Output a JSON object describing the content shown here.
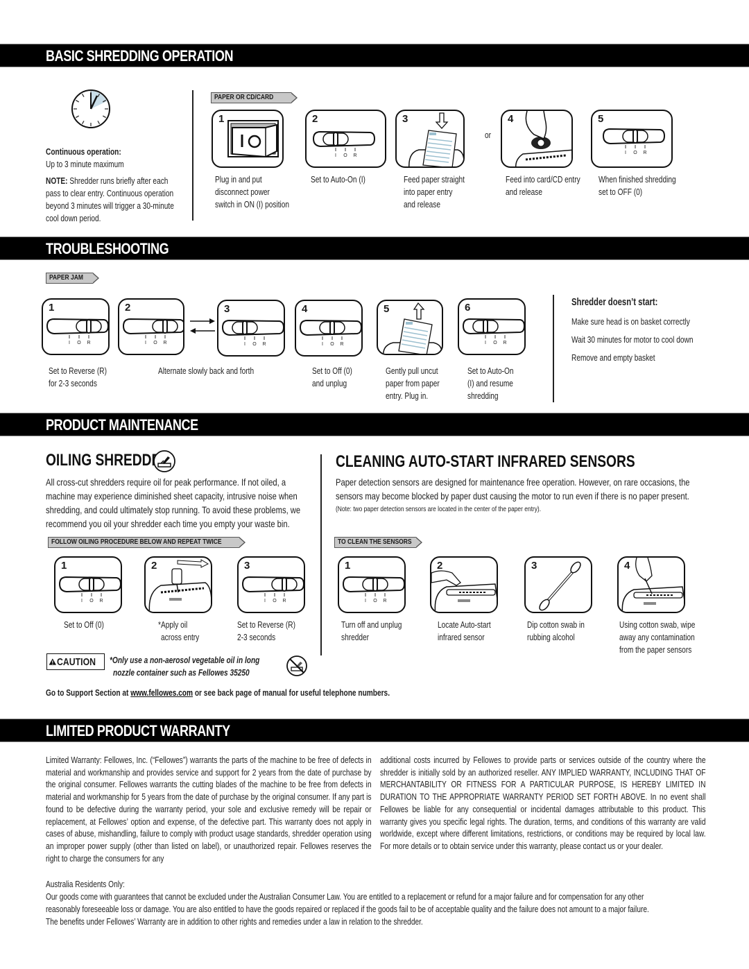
{
  "sections": {
    "basic": {
      "title": "BASIC SHREDDING OPERATION",
      "continuous_label": "Continuous operation:",
      "continuous_value": "Up to 3 minute maximum",
      "note_label": "NOTE:",
      "note_lines": [
        "Shredder runs briefly after each",
        "pass to clear entry. Continuous operation",
        "beyond 3 minutes will trigger a 30-minute",
        "cool down period."
      ],
      "tag": "PAPER OR CD/CARD",
      "or_label": "or",
      "steps": [
        {
          "num": "1",
          "lines": [
            "Plug in and put",
            "disconnect power",
            "switch in ON (I) position"
          ]
        },
        {
          "num": "2",
          "lines": [
            "Set to Auto-On (I)"
          ]
        },
        {
          "num": "3",
          "lines": [
            "Feed paper straight",
            "into paper entry",
            "and release"
          ]
        },
        {
          "num": "4",
          "lines": [
            "Feed into card/CD entry",
            "and release"
          ]
        },
        {
          "num": "5",
          "lines": [
            "When finished shredding",
            "set to OFF (0)"
          ]
        }
      ]
    },
    "troubleshooting": {
      "title": "TROUBLESHOOTING",
      "tag": "PAPER JAM",
      "steps": [
        {
          "num": "1",
          "lines": [
            "Set to Reverse (R)",
            "for 2-3 seconds"
          ]
        },
        {
          "num": "2",
          "lines": [
            "Alternate slowly back and forth"
          ]
        },
        {
          "num": "3",
          "lines": []
        },
        {
          "num": "4",
          "lines": [
            "Set to Off (0)",
            "and unplug"
          ]
        },
        {
          "num": "5",
          "lines": [
            "Gently pull uncut",
            "paper from paper",
            "entry. Plug in."
          ]
        },
        {
          "num": "6",
          "lines": [
            "Set to Auto-On",
            "(I) and resume",
            "shredding"
          ]
        }
      ],
      "no_start_title": "Shredder doesn’t start:",
      "no_start_items": [
        "Make sure head is on basket correctly",
        "Wait 30 minutes for motor to cool down",
        "Remove and empty basket"
      ]
    },
    "maintenance": {
      "title": "PRODUCT MAINTENANCE",
      "oiling": {
        "title": "OILING SHREDDER",
        "lines": [
          "All cross-cut shredders require oil for peak performance. If not oiled, a",
          "machine may experience diminished sheet capacity, intrusive noise when",
          "shredding, and could ultimately stop running. To avoid these problems, we",
          "recommend you oil your shredder each time you empty your waste bin."
        ],
        "tag": "FOLLOW OILING PROCEDURE BELOW AND REPEAT TWICE",
        "steps": [
          {
            "num": "1",
            "lines": [
              "Set to Off (0)"
            ]
          },
          {
            "num": "2",
            "lines": [
              "*Apply oil",
              "across entry"
            ]
          },
          {
            "num": "3",
            "lines": [
              "Set to Reverse (R)",
              "2-3 seconds"
            ]
          }
        ],
        "caution_label": "CAUTION",
        "caution_lines": [
          "*Only use a non-aerosol vegetable oil in long",
          "nozzle container such as Fellowes 35250"
        ]
      },
      "sensors": {
        "title": "CLEANING AUTO-START INFRARED SENSORS",
        "lines": [
          "Paper detection sensors are designed for maintenance free operation. However, on rare occasions, the",
          "sensors may become blocked by paper dust causing the motor to run even if there is no paper present."
        ],
        "note": "(Note: two paper detection sensors are located in the center of the paper entry).",
        "tag": "TO CLEAN THE SENSORS",
        "steps": [
          {
            "num": "1",
            "lines": [
              "Turn off and unplug",
              "shredder"
            ]
          },
          {
            "num": "2",
            "lines": [
              "Locate Auto-start",
              "infrared sensor"
            ]
          },
          {
            "num": "3",
            "lines": [
              "Dip cotton swab in",
              "rubbing alcohol"
            ]
          },
          {
            "num": "4",
            "lines": [
              "Using cotton swab, wipe",
              "away any contamination",
              "from the paper sensors"
            ]
          }
        ]
      },
      "support_pre": "Go to Support Section at ",
      "support_link": "www.fellowes.com",
      "support_post": " or see back page of manual for useful telephone numbers."
    },
    "warranty": {
      "title": "LIMITED PRODUCT WARRANTY",
      "col1": "Limited Warranty:  Fellowes, Inc. (“Fellowes”) warrants the parts of the machine to be free of defects in material and workmanship and provides service and support for 2 years from the date of purchase by the original consumer.  Fellowes warrants the cutting blades of the machine to be free from defects in material and workmanship for 5 years from the date of purchase by the original consumer. If any part is found to be defective during the warranty period, your sole and exclusive remedy will be repair or replacement, at Fellowes’ option and expense, of the defective part. This warranty does not apply in cases of abuse, mishandling, failure to comply with product usage standards, shredder operation using an improper power supply (other than listed on label), or unauthorized repair. Fellowes reserves the right to charge the consumers for any",
      "col2": "additional costs incurred by Fellowes to provide parts or services outside of the country where the shredder is initially sold by an authorized reseller. ANY IMPLIED WARRANTY, INCLUDING THAT OF MERCHANTABILITY OR FITNESS FOR A PARTICULAR PURPOSE, IS HEREBY LIMITED IN DURATION TO THE APPROPRIATE WARRANTY PERIOD SET FORTH ABOVE. In no event shall Fellowes be liable for any consequential or incidental damages attributable to this product. This warranty gives you specific legal rights. The duration, terms, and conditions of this warranty are valid worldwide, except where different limitations, restrictions, or conditions may be required by local law. For more details or to obtain service under this warranty, please contact us or your dealer.",
      "australia_label": "Australia Residents Only:",
      "australia_lines": [
        "Our goods come with guarantees that cannot be excluded under the Australian Consumer Law. You are entitled to a replacement or refund for a major failure and for compensation for any other",
        "reasonably foreseeable loss or damage. You are also entitled to have the goods repaired or replaced if the goods fail to be of acceptable quality and the failure does not amount to a major failure.",
        "The benefits under Fellowes’ Warranty are in addition to other rights and remedies under a law in relation to the shredder."
      ]
    }
  },
  "switch_labels": [
    "I",
    "O",
    "R"
  ],
  "icons": {
    "clock": "clock-icon",
    "oil": "oil-can-icon",
    "no_aerosol": "no-aerosol-icon",
    "caution": "warning-triangle-icon"
  }
}
